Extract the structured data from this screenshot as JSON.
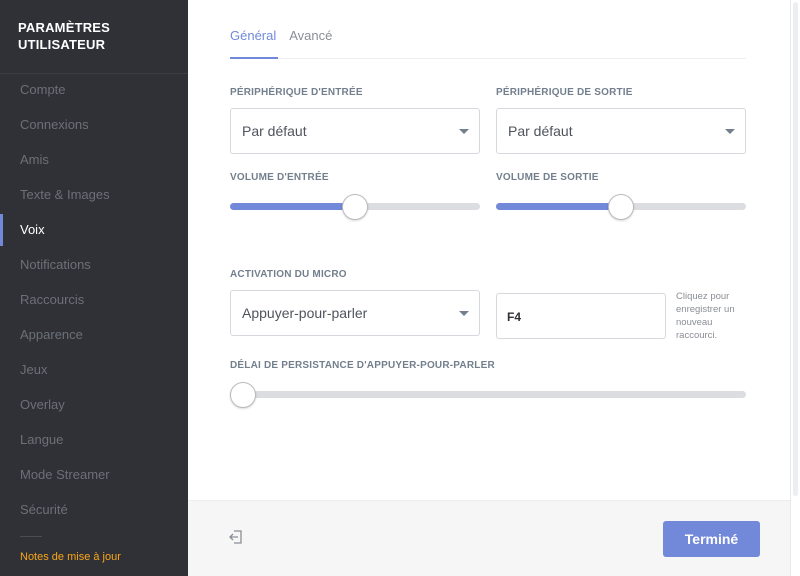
{
  "sidebar": {
    "title": "PARAMÈTRES UTILISATEUR",
    "items": [
      {
        "label": "Compte"
      },
      {
        "label": "Connexions"
      },
      {
        "label": "Amis"
      },
      {
        "label": "Texte & Images"
      },
      {
        "label": "Voix",
        "active": true
      },
      {
        "label": "Notifications"
      },
      {
        "label": "Raccourcis"
      },
      {
        "label": "Apparence"
      },
      {
        "label": "Jeux"
      },
      {
        "label": "Overlay"
      },
      {
        "label": "Langue"
      },
      {
        "label": "Mode Streamer"
      },
      {
        "label": "Sécurité"
      }
    ],
    "footer_link": "Notes de mise à jour"
  },
  "tabs": [
    {
      "label": "Général",
      "active": true
    },
    {
      "label": "Avancé"
    }
  ],
  "devices": {
    "input_label": "PÉRIPHÉRIQUE D'ENTRÉE",
    "input_value": "Par défaut",
    "output_label": "PÉRIPHÉRIQUE DE SORTIE",
    "output_value": "Par défaut"
  },
  "volume": {
    "input_label": "VOLUME D'ENTRÉE",
    "input_level": 0.5,
    "output_label": "VOLUME DE SORTIE",
    "output_level": 0.5
  },
  "mic": {
    "activation_label": "ACTIVATION DU MICRO",
    "activation_value": "Appuyer-pour-parler",
    "keybind_value": "F4",
    "keybind_hint": "Cliquez pour enregistrer un nouveau raccourci."
  },
  "ptt_delay": {
    "label": "DÉLAI DE PERSISTANCE D'APPUYER-POUR-PARLER",
    "level": 0.0
  },
  "footer": {
    "done_label": "Terminé",
    "logout_icon": "logout-icon"
  },
  "colors": {
    "accent": "#7289da",
    "sidebar_bg": "#2f3136",
    "footer_link": "#faa61a"
  }
}
